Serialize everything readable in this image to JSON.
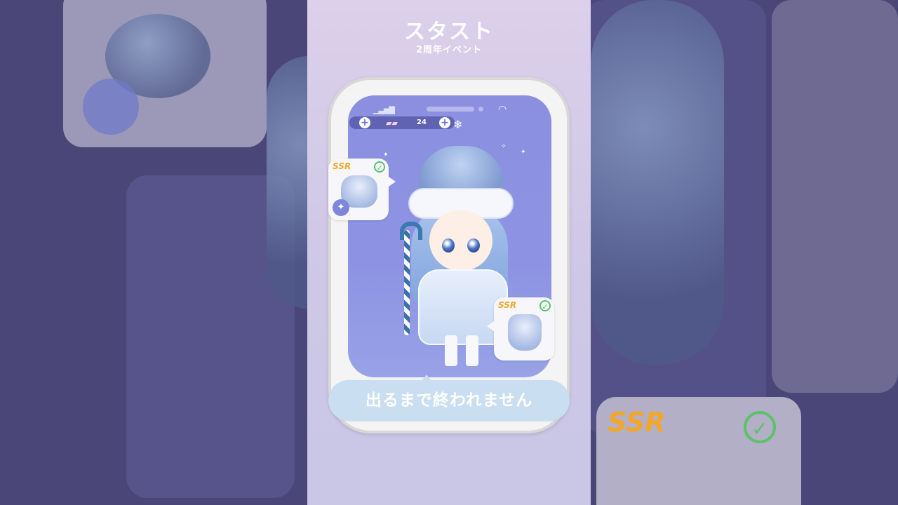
{
  "header": {
    "title": "スタスト",
    "subtitle": "2周年イベント"
  },
  "status_bar": {
    "signal_icon": "signal-icon",
    "wifi_icon": "wifi-icon"
  },
  "hud": {
    "currency_count": "24",
    "left_plus": "+",
    "right_plus": "+"
  },
  "cards": {
    "hat": {
      "rarity": "SSR",
      "checked": true,
      "star_label": "✦"
    },
    "dress": {
      "rarity": "SSR",
      "checked": true
    }
  },
  "background": {
    "ssr_label": "SSR"
  },
  "banner": {
    "text": "出るまで終われません"
  },
  "colors": {
    "ssr": "#f2a72a",
    "check": "#5cc26a",
    "screen": "#8c8fe0",
    "banner": "#c9def0"
  }
}
